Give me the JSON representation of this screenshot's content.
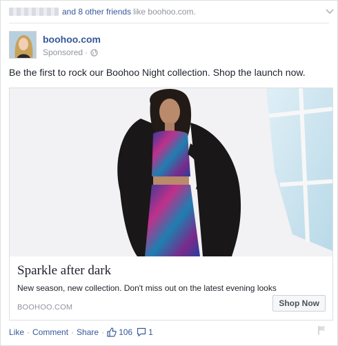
{
  "social_context": {
    "blurred_name_hint": "",
    "friends_text": "and 8 other friends",
    "tail_text": "like boohoo.com."
  },
  "header": {
    "page_name": "boohoo.com",
    "sponsored_label": "Sponsored",
    "separator": "·"
  },
  "post": {
    "text": "Be the first to rock our Boohoo Night collection. Shop the launch now."
  },
  "attachment": {
    "title": "Sparkle after dark",
    "description": "New season, new collection. Don't miss out on the latest evening looks",
    "domain": "BOOHOO.COM",
    "cta_label": "Shop Now"
  },
  "footer": {
    "like_label": "Like",
    "comment_label": "Comment",
    "share_label": "Share",
    "separator": "·",
    "like_count": "106",
    "comment_count": "1"
  },
  "colors": {
    "link_blue": "#365899",
    "muted_gray": "#90949c",
    "text_dark": "#1d2129"
  },
  "icons": {
    "chevron": "chevron-down-icon",
    "globe": "globe-icon",
    "thumb": "thumbs-up-icon",
    "comment": "comment-bubble-icon",
    "flag": "flag-icon"
  }
}
